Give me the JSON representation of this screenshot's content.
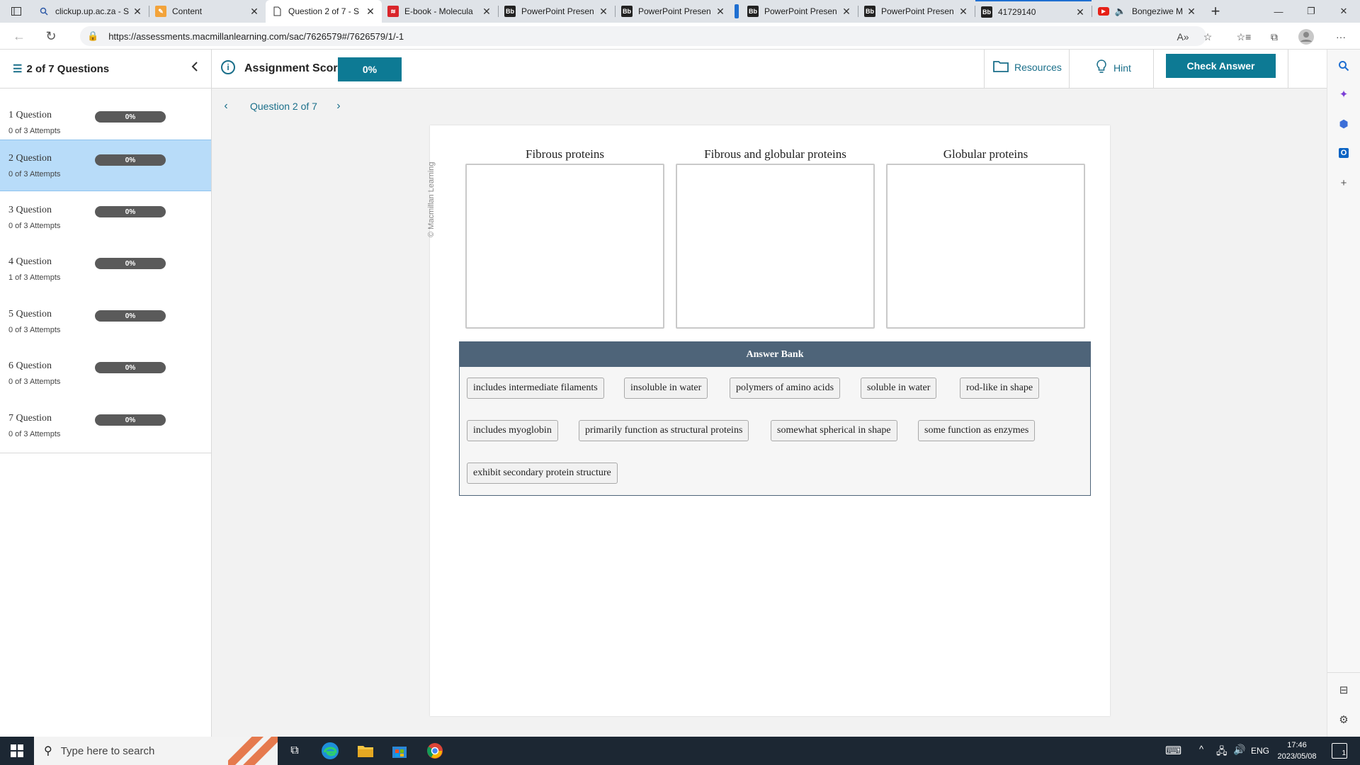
{
  "browser": {
    "tabs": [
      {
        "title": "clickup.up.ac.za - S",
        "icon": "search-icon"
      },
      {
        "title": "Content",
        "icon": "pencil-icon"
      },
      {
        "title": "Question 2 of 7 - S",
        "icon": "page-icon",
        "active": true
      },
      {
        "title": "E-book - Molecula",
        "icon": "macmillan-icon"
      },
      {
        "title": "PowerPoint Presen",
        "icon": "bb-icon"
      },
      {
        "title": "PowerPoint Presen",
        "icon": "bb-icon"
      },
      {
        "title": "PowerPoint Presen",
        "icon": "bb-icon"
      },
      {
        "title": "PowerPoint Presen",
        "icon": "bb-icon"
      },
      {
        "title": "41729140",
        "icon": "bb-icon"
      },
      {
        "title": "Bongeziwe M",
        "icon": "youtube-icon"
      }
    ],
    "bb_label": "Bb",
    "url": "https://assessments.macmillanlearning.com/sac/7626579#/7626579/1/-1"
  },
  "header": {
    "question_count": "2 of 7 Questions",
    "score_label": "Assignment Score:",
    "score_value": "0%",
    "resources_label": "Resources",
    "hint_label": "Hint",
    "check_answer_label": "Check Answer"
  },
  "questions": [
    {
      "name": "1 Question",
      "attempts": "0 of 3 Attempts",
      "score": "0%"
    },
    {
      "name": "2 Question",
      "attempts": "0 of 3 Attempts",
      "score": "0%",
      "active": true
    },
    {
      "name": "3 Question",
      "attempts": "0 of 3 Attempts",
      "score": "0%"
    },
    {
      "name": "4 Question",
      "attempts": "1 of 3 Attempts",
      "score": "0%"
    },
    {
      "name": "5 Question",
      "attempts": "0 of 3 Attempts",
      "score": "0%"
    },
    {
      "name": "6 Question",
      "attempts": "0 of 3 Attempts",
      "score": "0%"
    },
    {
      "name": "7 Question",
      "attempts": "0 of 3 Attempts",
      "score": "0%"
    }
  ],
  "question_nav": {
    "label": "Question 2 of 7"
  },
  "watermark": "© Macmillan Learning",
  "bins": [
    {
      "title": "Fibrous proteins"
    },
    {
      "title": "Fibrous and globular proteins"
    },
    {
      "title": "Globular proteins"
    }
  ],
  "answer_bank": {
    "title": "Answer Bank",
    "items": [
      "includes intermediate filaments",
      "insoluble in water",
      "polymers of amino acids",
      "soluble in water",
      "rod-like in shape",
      "includes myoglobin",
      "primarily function as structural proteins",
      "somewhat spherical in shape",
      "some function as enzymes",
      "exhibit secondary protein structure"
    ]
  },
  "taskbar": {
    "search_placeholder": "Type here to search",
    "language": "ENG",
    "time": "17:46",
    "date": "2023/05/08",
    "notification_count": "1"
  },
  "colors": {
    "accent": "#0d7a94",
    "active_question": "#b8dcf9",
    "bank_header": "#4e6479",
    "taskbar": "#1c2733"
  }
}
